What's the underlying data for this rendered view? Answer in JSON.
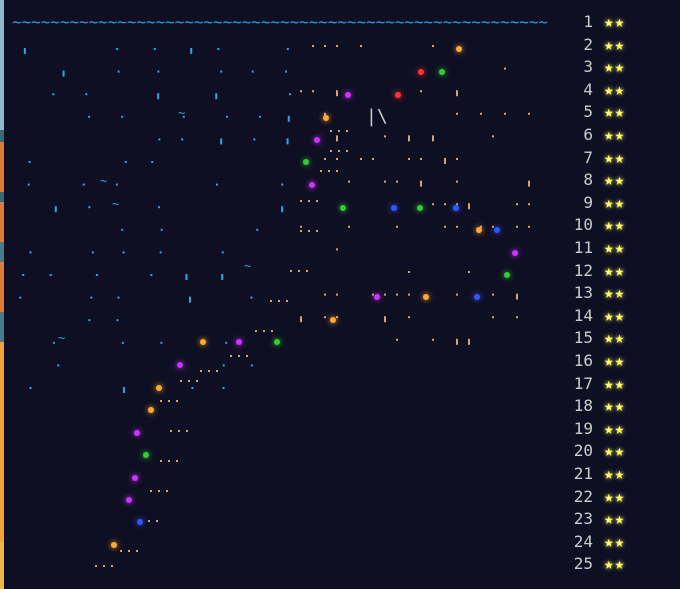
{
  "calendar": {
    "days": [
      {
        "day": "1",
        "stars": "★★"
      },
      {
        "day": "2",
        "stars": "★★"
      },
      {
        "day": "3",
        "stars": "★★"
      },
      {
        "day": "4",
        "stars": "★★"
      },
      {
        "day": "5",
        "stars": "★★"
      },
      {
        "day": "6",
        "stars": "★★"
      },
      {
        "day": "7",
        "stars": "★★"
      },
      {
        "day": "8",
        "stars": "★★"
      },
      {
        "day": "9",
        "stars": "★★"
      },
      {
        "day": "10",
        "stars": "★★"
      },
      {
        "day": "11",
        "stars": "★★"
      },
      {
        "day": "12",
        "stars": "★★"
      },
      {
        "day": "13",
        "stars": "★★"
      },
      {
        "day": "14",
        "stars": "★★"
      },
      {
        "day": "15",
        "stars": "★★"
      },
      {
        "day": "16",
        "stars": "★★"
      },
      {
        "day": "17",
        "stars": "★★"
      },
      {
        "day": "18",
        "stars": "★★"
      },
      {
        "day": "19",
        "stars": "★★"
      },
      {
        "day": "20",
        "stars": "★★"
      },
      {
        "day": "21",
        "stars": "★★"
      },
      {
        "day": "22",
        "stars": "★★"
      },
      {
        "day": "23",
        "stars": "★★"
      },
      {
        "day": "24",
        "stars": "★★"
      },
      {
        "day": "25",
        "stars": "★★"
      }
    ]
  },
  "art": {
    "wave_line": "~~~~~~~~~~~~~~~~~~~~~~~~~~~~~~~~~~~~~~~~~~~~~~~~~~~~~~~~",
    "wave_text": "~",
    "lighthouse_text": "|\\",
    "colors": {
      "background": "#0f0f23",
      "sea": "#2fa6e0",
      "sand": "#d4a373",
      "star": "#ffff66",
      "text": "#cccccc"
    }
  }
}
